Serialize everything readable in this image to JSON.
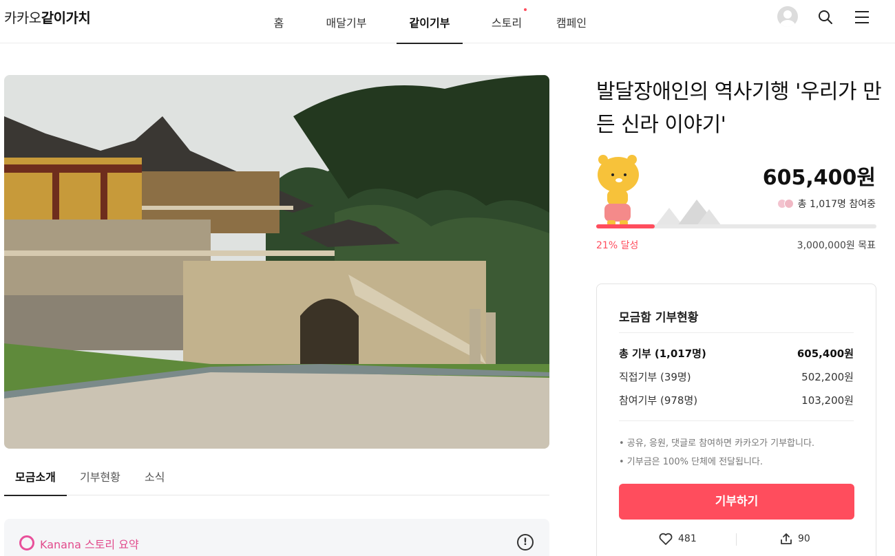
{
  "header": {
    "logo_light": "카카오",
    "logo_bold": "같이가치",
    "nav": [
      {
        "label": "홈"
      },
      {
        "label": "매달기부"
      },
      {
        "label": "같이기부",
        "active": true
      },
      {
        "label": "스토리",
        "dot": true
      },
      {
        "label": "캠페인"
      }
    ],
    "icons": [
      "avatar-icon",
      "search-icon",
      "menu-icon"
    ]
  },
  "campaign": {
    "title": "발달장애인의 역사기행 '우리가 만든 신라 이야기'",
    "amount": "605,400원",
    "participants": "총 1,017명 참여중",
    "progress": 0.21,
    "percent_label": "21% 달성",
    "goal_label": "3,000,000원 목표"
  },
  "tabs": [
    {
      "label": "모금소개",
      "active": true
    },
    {
      "label": "기부현황"
    },
    {
      "label": "소식"
    }
  ],
  "summary": {
    "label": "Kanana 스토리 요약",
    "info_icon": "!"
  },
  "card": {
    "title": "모금함 기부현황",
    "rows": [
      {
        "label": "총 기부 (1,017명)",
        "value": "605,400원"
      },
      {
        "label": "직접기부 (39명)",
        "value": "502,200원"
      },
      {
        "label": "참여기부 (978명)",
        "value": "103,200원"
      }
    ],
    "notes": [
      "• 공유, 응원, 댓글로 참여하면 카카오가 기부합니다.",
      "• 기부금은 100% 단체에 전달됩니다."
    ],
    "donate_label": "기부하기",
    "like_count": "481",
    "share_count": "90"
  },
  "colors": {
    "accent": "#ff4d5d",
    "kanana": "#e24b8c"
  }
}
